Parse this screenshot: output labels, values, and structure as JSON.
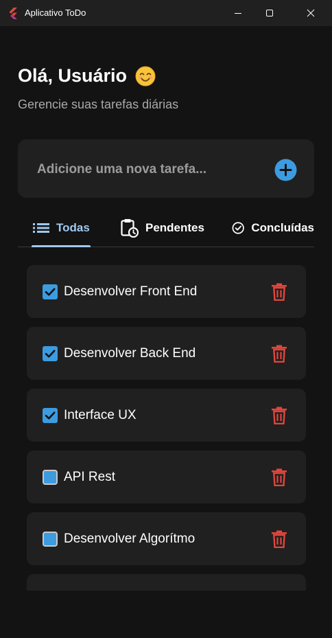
{
  "window": {
    "title": "Aplicativo ToDo",
    "logo_icon": "flutter-logo-icon",
    "controls": [
      "minimize-icon",
      "maximize-icon",
      "close-icon"
    ]
  },
  "header": {
    "greeting": "Olá, Usuário",
    "emoji_icon": "smiling-face-icon",
    "subtitle": "Gerencie suas tarefas diárias"
  },
  "add_task": {
    "placeholder": "Adicione uma nova tarefa...",
    "value": "",
    "button_icon": "plus-circle-icon"
  },
  "tabs": [
    {
      "label": "Todas",
      "icon": "list-icon",
      "selected": true
    },
    {
      "label": "Pendentes",
      "icon": "clipboard-clock-icon",
      "selected": false
    },
    {
      "label": "Concluídas",
      "icon": "check-circle-icon",
      "selected": false
    }
  ],
  "tasks": [
    {
      "label": "Desenvolver Front End",
      "done": true
    },
    {
      "label": "Desenvolver Back End",
      "done": true
    },
    {
      "label": "Interface UX",
      "done": true
    },
    {
      "label": "API Rest",
      "done": false
    },
    {
      "label": "Desenvolver Algorítmo",
      "done": false
    }
  ],
  "colors": {
    "background": "#131313",
    "card": "#202020",
    "accent": "#3d9be0",
    "tab_selected": "#9fc9ef",
    "delete": "#e0463c",
    "subtitle": "#a9a9a9"
  }
}
